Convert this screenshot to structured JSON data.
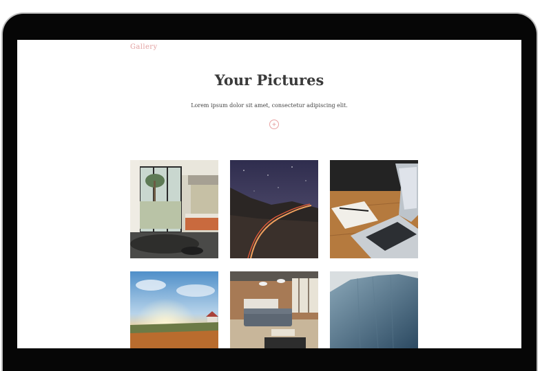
{
  "nav": {
    "gallery_label": "Gallery"
  },
  "header": {
    "title": "Your Pictures",
    "subtitle": "Lorem ipsum dolor sit amet, consectetur adipiscing elit."
  },
  "add_button": {
    "icon": "plus-icon"
  },
  "colors": {
    "accent": "#e3a1a1",
    "title": "#3a3a3a",
    "device_frame": "#060606"
  },
  "gallery": {
    "photos": [
      {
        "subject": "modern bedroom interior"
      },
      {
        "subject": "night road under starry sky"
      },
      {
        "subject": "laptop and notebook on wooden desk"
      },
      {
        "subject": "sunset over flower meadow"
      },
      {
        "subject": "living room with grey sofa"
      },
      {
        "subject": "blue rock cliff"
      }
    ]
  }
}
